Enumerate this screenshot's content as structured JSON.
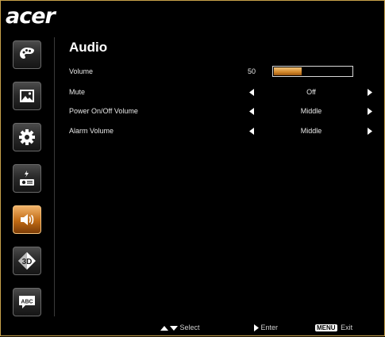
{
  "brand": {
    "logo": "acer"
  },
  "sidebar": {
    "items": [
      {
        "name": "color",
        "icon": "palette-icon"
      },
      {
        "name": "image",
        "icon": "picture-icon"
      },
      {
        "name": "setting",
        "icon": "gear-icon"
      },
      {
        "name": "management",
        "icon": "power-source-icon"
      },
      {
        "name": "audio",
        "icon": "speaker-icon",
        "active": true
      },
      {
        "name": "3d",
        "icon": "3d-icon",
        "label": "3D"
      },
      {
        "name": "language",
        "icon": "abc-speech-icon",
        "label": "ABC"
      }
    ]
  },
  "page": {
    "title": "Audio"
  },
  "settings": [
    {
      "label": "Volume",
      "value": "50",
      "level_percent": 50
    },
    {
      "label": "Mute",
      "value": "Off"
    },
    {
      "label": "Power On/Off Volume",
      "value": "Middle"
    },
    {
      "label": "Alarm Volume",
      "value": "Middle"
    }
  ],
  "footer": {
    "select_label": "Select",
    "enter_label": "Enter",
    "menu_key": "MENU",
    "exit_label": "Exit"
  },
  "colors": {
    "accent": "#d2872a",
    "border": "#c8a24a"
  }
}
